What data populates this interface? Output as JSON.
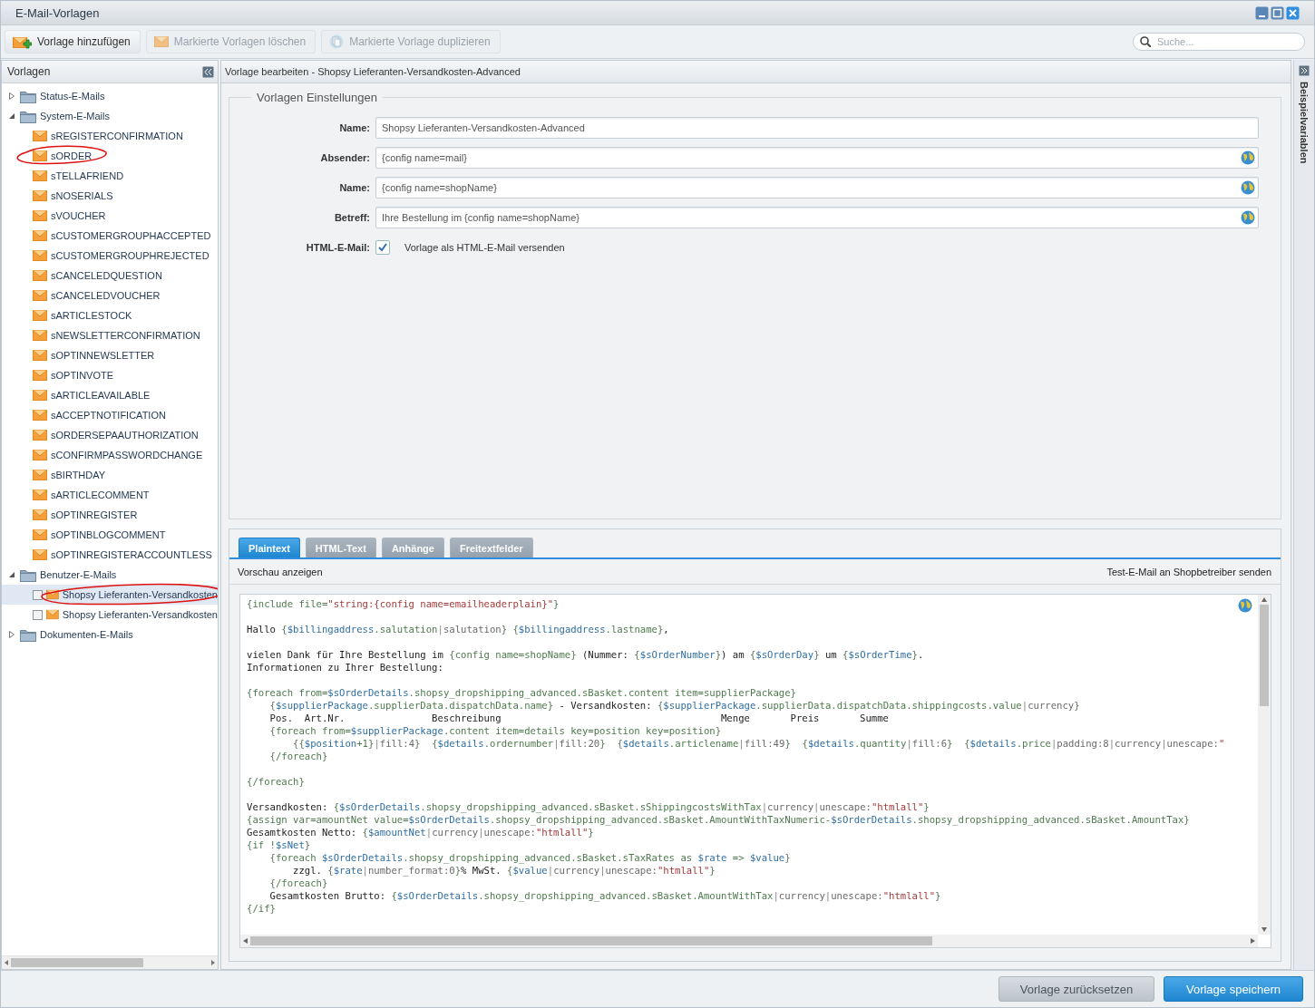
{
  "window": {
    "title": "E-Mail-Vorlagen"
  },
  "toolbar": [
    {
      "label": "Vorlage hinzufügen",
      "disabled": false
    },
    {
      "label": "Markierte Vorlagen löschen",
      "disabled": true
    },
    {
      "label": "Markierte Vorlage duplizieren",
      "disabled": true
    }
  ],
  "search": {
    "placeholder": "Suche..."
  },
  "sidebar": {
    "title": "Vorlagen",
    "items": [
      {
        "label": "Status-E-Mails",
        "expanded": false
      },
      {
        "label": "System-E-Mails",
        "expanded": true,
        "children": [
          {
            "label": "sREGISTERCONFIRMATION",
            "kind": "mail",
            "selected": false,
            "circled": false
          },
          {
            "label": "sORDER",
            "kind": "mail",
            "selected": false,
            "circled": true
          },
          {
            "label": "sTELLAFRIEND",
            "kind": "mail",
            "selected": false,
            "circled": false
          },
          {
            "label": "sNOSERIALS",
            "kind": "mail",
            "selected": false,
            "circled": false
          },
          {
            "label": "sVOUCHER",
            "kind": "mail",
            "selected": false,
            "circled": false
          },
          {
            "label": "sCUSTOMERGROUPHACCEPTED",
            "kind": "mail",
            "selected": false,
            "circled": false
          },
          {
            "label": "sCUSTOMERGROUPHREJECTED",
            "kind": "mail",
            "selected": false,
            "circled": false
          },
          {
            "label": "sCANCELEDQUESTION",
            "kind": "mail",
            "selected": false,
            "circled": false
          },
          {
            "label": "sCANCELEDVOUCHER",
            "kind": "mail",
            "selected": false,
            "circled": false
          },
          {
            "label": "sARTICLESTOCK",
            "kind": "mail",
            "selected": false,
            "circled": false
          },
          {
            "label": "sNEWSLETTERCONFIRMATION",
            "kind": "mail",
            "selected": false,
            "circled": false
          },
          {
            "label": "sOPTINNEWSLETTER",
            "kind": "mail",
            "selected": false,
            "circled": false
          },
          {
            "label": "sOPTINVOTE",
            "kind": "mail",
            "selected": false,
            "circled": false
          },
          {
            "label": "sARTICLEAVAILABLE",
            "kind": "mail",
            "selected": false,
            "circled": false
          },
          {
            "label": "sACCEPTNOTIFICATION",
            "kind": "mail",
            "selected": false,
            "circled": false
          },
          {
            "label": "sORDERSEPAAUTHORIZATION",
            "kind": "mail",
            "selected": false,
            "circled": false
          },
          {
            "label": "sCONFIRMPASSWORDCHANGE",
            "kind": "mail",
            "selected": false,
            "circled": false
          },
          {
            "label": "sBIRTHDAY",
            "kind": "mail",
            "selected": false,
            "circled": false
          },
          {
            "label": "sARTICLECOMMENT",
            "kind": "mail",
            "selected": false,
            "circled": false
          },
          {
            "label": "sOPTINREGISTER",
            "kind": "mail",
            "selected": false,
            "circled": false
          },
          {
            "label": "sOPTINBLOGCOMMENT",
            "kind": "mail",
            "selected": false,
            "circled": false
          },
          {
            "label": "sOPTINREGISTERACCOUNTLESS",
            "kind": "mail",
            "selected": false,
            "circled": false
          }
        ]
      },
      {
        "label": "Benutzer-E-Mails",
        "expanded": true,
        "children": [
          {
            "label": "Shopsy Lieferanten-Versandkosten",
            "kind": "checkable",
            "checked": false,
            "selected": true,
            "circled": true
          },
          {
            "label": "Shopsy Lieferanten-Versandkosten",
            "kind": "checkable",
            "checked": false,
            "selected": false,
            "circled": false
          }
        ]
      },
      {
        "label": "Dokumenten-E-Mails",
        "expanded": false
      }
    ]
  },
  "editor": {
    "title": "Vorlage bearbeiten - Shopsy Lieferanten-Versandkosten-Advanced",
    "settings_title": "Vorlagen Einstellungen",
    "fields": [
      {
        "kind": "text",
        "label": "Name:",
        "value": "Shopsy Lieferanten-Versandkosten-Advanced",
        "globe": false
      },
      {
        "kind": "text",
        "label": "Absender:",
        "value": "{config name=mail}",
        "globe": true
      },
      {
        "kind": "text",
        "label": "Name:",
        "value": "{config name=shopName}",
        "globe": true
      },
      {
        "kind": "text",
        "label": "Betreff:",
        "value": "Ihre Bestellung im {config name=shopName}",
        "globe": true
      },
      {
        "kind": "checkbox",
        "label": "HTML-E-Mail:",
        "checked": true,
        "caption": "Vorlage als HTML-E-Mail versenden"
      }
    ],
    "tabs": [
      {
        "label": "Plaintext",
        "selected": true
      },
      {
        "label": "HTML-Text",
        "selected": false
      },
      {
        "label": "Anhänge",
        "selected": false
      },
      {
        "label": "Freitextfelder",
        "selected": false
      }
    ],
    "preview_link": "Vorschau anzeigen",
    "test_link": "Test-E-Mail an Shopbetreiber senden",
    "code": "{include file=\"string:{config name=emailheaderplain}\"}\n\nHallo {$billingaddress.salutation|salutation} {$billingaddress.lastname},\n\nvielen Dank für Ihre Bestellung im {config name=shopName} (Nummer: {$sOrderNumber}) am {$sOrderDay} um {$sOrderTime}.\nInformationen zu Ihrer Bestellung:\n\n{foreach from=$sOrderDetails.shopsy_dropshipping_advanced.sBasket.content item=supplierPackage}\n    {$supplierPackage.supplierData.dispatchData.name} - Versandkosten: {$supplierPackage.supplierData.dispatchData.shippingcosts.value|currency}\n    Pos.  Art.Nr.               Beschreibung                                      Menge       Preis       Summe\n    {foreach from=$supplierPackage.content item=details key=position key=position}\n        {{$position+1}|fill:4}  {$details.ordernumber|fill:20}  {$details.articlename|fill:49}  {$details.quantity|fill:6}  {$details.price|padding:8|currency|unescape:\"\n    {/foreach}\n\n{/foreach}\n\nVersandkosten: {$sOrderDetails.shopsy_dropshipping_advanced.sBasket.sShippingcostsWithTax|currency|unescape:\"htmlall\"}\n{assign var=amountNet value=$sOrderDetails.shopsy_dropshipping_advanced.sBasket.AmountWithTaxNumeric-$sOrderDetails.shopsy_dropshipping_advanced.sBasket.AmountTax}\nGesamtkosten Netto: {$amountNet|currency|unescape:\"htmlall\"}\n{if !$sNet}\n    {foreach $sOrderDetails.shopsy_dropshipping_advanced.sBasket.sTaxRates as $rate => $value}\n        zzgl. {$rate|number_format:0}% MwSt. {$value|currency|unescape:\"htmlall\"}\n    {/foreach}\n    Gesamtkosten Brutto: {$sOrderDetails.shopsy_dropshipping_advanced.sBasket.AmountWithTax|currency|unescape:\"htmlall\"}\n{/if}"
  },
  "side_panel": {
    "title": "Beispielvariablen"
  },
  "buttons": [
    {
      "label": "Vorlage zurücksetzen",
      "kind": "secondary"
    },
    {
      "label": "Vorlage speichern",
      "kind": "primary"
    }
  ]
}
